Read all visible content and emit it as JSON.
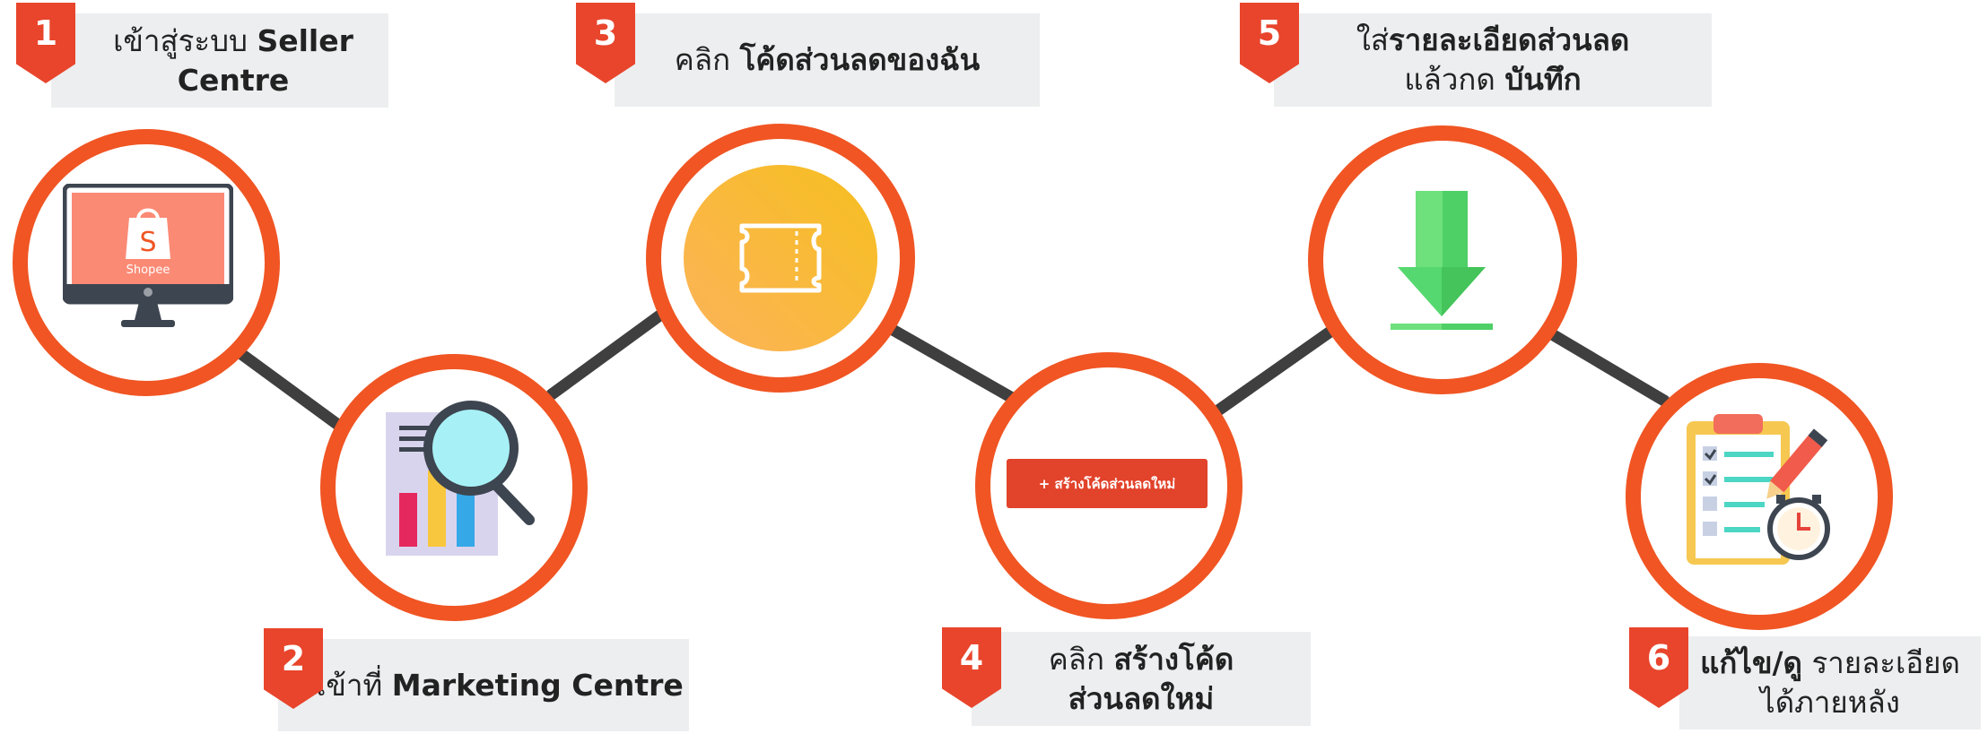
{
  "steps": [
    {
      "num": "1",
      "text": "เข้าสู่ระบบ ",
      "bold": "Seller",
      "line2": "Centre"
    },
    {
      "num": "2",
      "text": "เข้าที่ ",
      "bold": "Marketing Centre"
    },
    {
      "num": "3",
      "text": "คลิก ",
      "bold": "โค้ดส่วนลดของฉัน"
    },
    {
      "num": "4",
      "text": "คลิก ",
      "bold": "สร้างโค้ด",
      "line2": "ส่วนลดใหม่"
    },
    {
      "num": "5",
      "text": "ใส่",
      "bold": "รายละเอียดส่วนลด",
      "line2a": "แล้วกด ",
      "line2b": "บันทึก"
    },
    {
      "num": "6",
      "bold": "แก้ไข/ดู",
      "text": " รายละเอียด",
      "line2": "ได้ภายหลัง"
    }
  ],
  "shopee_text": "Shopee",
  "create_button": "+ สร้างโค้ดส่วนลดใหม่",
  "colors": {
    "accent": "#f05523",
    "badge": "#e8452c",
    "connector": "#3f3f3f",
    "label_bg": "#eceeef"
  }
}
